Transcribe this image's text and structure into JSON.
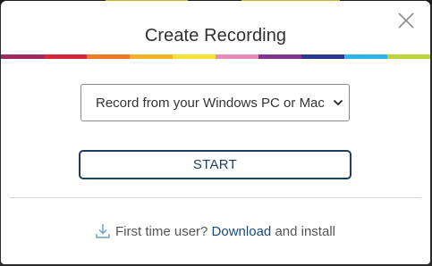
{
  "modal": {
    "title": "Create Recording",
    "close_icon": "close-x-icon",
    "rainbow_colors": [
      "#9c2a5e",
      "#d4283a",
      "#ee7a28",
      "#f3b22a",
      "#f4e238",
      "#e78ab8",
      "#7e3690",
      "#283a8e",
      "#2fb4e3",
      "#bcd43a"
    ],
    "source_select": {
      "selected": "Record from your Windows PC or Mac",
      "icon": "chevron-down-icon"
    },
    "start_label": "START",
    "footer": {
      "icon": "download-icon",
      "prefix": "First time user?",
      "link": "Download",
      "suffix": "and install"
    }
  },
  "colors": {
    "accent": "#1d3e5c",
    "link": "#1a4a7a"
  }
}
